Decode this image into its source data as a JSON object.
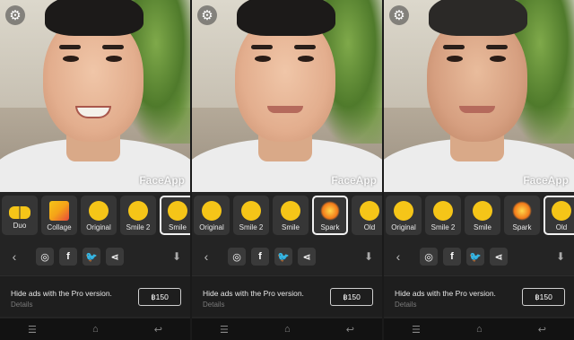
{
  "watermark": "FaceApp",
  "panels": [
    {
      "filters": [
        {
          "label": "Duo",
          "icon": "duo-emoji-icon"
        },
        {
          "label": "Collage",
          "icon": "collage-emoji-icon"
        },
        {
          "label": "Original",
          "icon": "neutral-emoji-icon"
        },
        {
          "label": "Smile 2",
          "icon": "grin-emoji-icon"
        },
        {
          "label": "Smile",
          "icon": "smile-emoji-icon",
          "selected": true
        }
      ]
    },
    {
      "filters": [
        {
          "label": "Original",
          "icon": "neutral-emoji-icon"
        },
        {
          "label": "Smile 2",
          "icon": "grin-emoji-icon"
        },
        {
          "label": "Smile",
          "icon": "smile-emoji-icon"
        },
        {
          "label": "Spark",
          "icon": "spark-icon",
          "selected": true
        },
        {
          "label": "Old",
          "icon": "old-emoji-icon"
        }
      ]
    },
    {
      "filters": [
        {
          "label": "Original",
          "icon": "neutral-emoji-icon"
        },
        {
          "label": "Smile 2",
          "icon": "grin-emoji-icon"
        },
        {
          "label": "Smile",
          "icon": "smile-emoji-icon"
        },
        {
          "label": "Spark",
          "icon": "spark-icon"
        },
        {
          "label": "Old",
          "icon": "old-emoji-icon",
          "selected": true
        }
      ]
    }
  ],
  "ad": {
    "text": "Hide ads with the Pro version.",
    "details": "Details",
    "price": "฿150"
  },
  "colors": {
    "background": "#242424",
    "emoji": "#f5c518",
    "selected_border": "#f2f2f2"
  }
}
